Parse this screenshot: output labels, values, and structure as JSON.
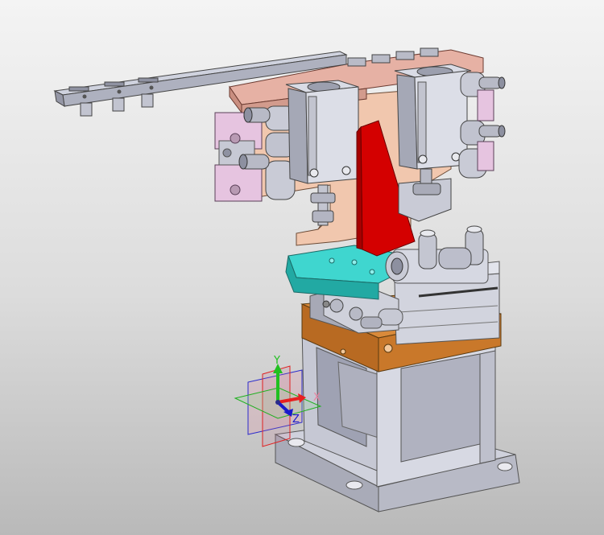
{
  "viewport": {
    "background_top": "#f4f4f4",
    "background_bottom": "#b9b9b9"
  },
  "model": {
    "colors": {
      "steel": "#c9ccd8",
      "steel_dark": "#8d90a0",
      "plate_pink": "#e2b4a6",
      "plate_peach": "#f0c8ae",
      "block_pink": "#e3c3dc",
      "gusset_red": "#d90000",
      "plate_cyan": "#35cfc8",
      "plate_copper": "#d07a2a",
      "rail": "#b7bac7"
    }
  },
  "triad": {
    "x_label": "X",
    "y_label": "Y",
    "z_label": "Z",
    "x_color": "#e82020",
    "y_color": "#20c020",
    "z_color": "#1a1acc"
  }
}
